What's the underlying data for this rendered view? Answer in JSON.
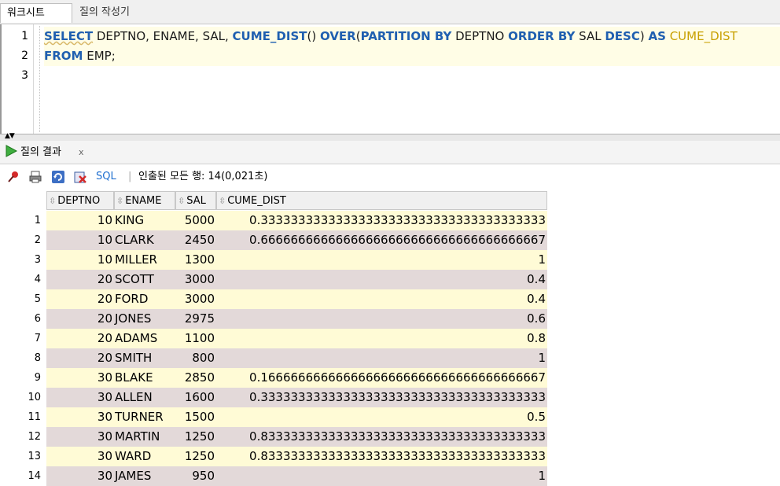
{
  "tabs": [
    {
      "label": "워크시트"
    },
    {
      "label": "질의 작성기"
    }
  ],
  "editor": {
    "line_numbers": [
      "1",
      "2",
      "3"
    ],
    "line1": {
      "select": "SELECT",
      "cols": " DEPTNO, ENAME, SAL, ",
      "cume": "CUME_DIST",
      "paren": "() ",
      "over": "OVER",
      "open": "(",
      "partition_by": "PARTITION BY",
      "dept": " DEPTNO ",
      "order_by": "ORDER BY",
      "sal_desc_a": " SAL ",
      "desc": "DESC",
      "close": ") ",
      "as": "AS",
      "space": " ",
      "alias": "CUME_DIST"
    },
    "line2": {
      "from": "FROM",
      "table": " EMP;"
    }
  },
  "result_tab": {
    "label": "질의 결과",
    "close": "x"
  },
  "toolbar": {
    "sql_label": "SQL",
    "separator": "|",
    "info": "인출된 모든 행: 14(0,021초)"
  },
  "grid": {
    "columns": [
      "DEPTNO",
      "ENAME",
      "SAL",
      "CUME_DIST"
    ],
    "rows": [
      {
        "n": "1",
        "deptno": "10",
        "ename": "KING",
        "sal": "5000",
        "cume": "0.33333333333333333333333333333333333333"
      },
      {
        "n": "2",
        "deptno": "10",
        "ename": "CLARK",
        "sal": "2450",
        "cume": "0.66666666666666666666666666666666666667"
      },
      {
        "n": "3",
        "deptno": "10",
        "ename": "MILLER",
        "sal": "1300",
        "cume": "1"
      },
      {
        "n": "4",
        "deptno": "20",
        "ename": "SCOTT",
        "sal": "3000",
        "cume": "0.4"
      },
      {
        "n": "5",
        "deptno": "20",
        "ename": "FORD",
        "sal": "3000",
        "cume": "0.4"
      },
      {
        "n": "6",
        "deptno": "20",
        "ename": "JONES",
        "sal": "2975",
        "cume": "0.6"
      },
      {
        "n": "7",
        "deptno": "20",
        "ename": "ADAMS",
        "sal": "1100",
        "cume": "0.8"
      },
      {
        "n": "8",
        "deptno": "20",
        "ename": "SMITH",
        "sal": "800",
        "cume": "1"
      },
      {
        "n": "9",
        "deptno": "30",
        "ename": "BLAKE",
        "sal": "2850",
        "cume": "0.16666666666666666666666666666666666667"
      },
      {
        "n": "10",
        "deptno": "30",
        "ename": "ALLEN",
        "sal": "1600",
        "cume": "0.33333333333333333333333333333333333333"
      },
      {
        "n": "11",
        "deptno": "30",
        "ename": "TURNER",
        "sal": "1500",
        "cume": "0.5"
      },
      {
        "n": "12",
        "deptno": "30",
        "ename": "MARTIN",
        "sal": "1250",
        "cume": "0.83333333333333333333333333333333333333"
      },
      {
        "n": "13",
        "deptno": "30",
        "ename": "WARD",
        "sal": "1250",
        "cume": "0.83333333333333333333333333333333333333"
      },
      {
        "n": "14",
        "deptno": "30",
        "ename": "JAMES",
        "sal": "950",
        "cume": "1"
      }
    ]
  },
  "colors": {
    "keyword": "#1f5fb0",
    "alias": "#c8a000",
    "row_odd": "#fffbd6",
    "row_even": "#e3d9d9"
  }
}
